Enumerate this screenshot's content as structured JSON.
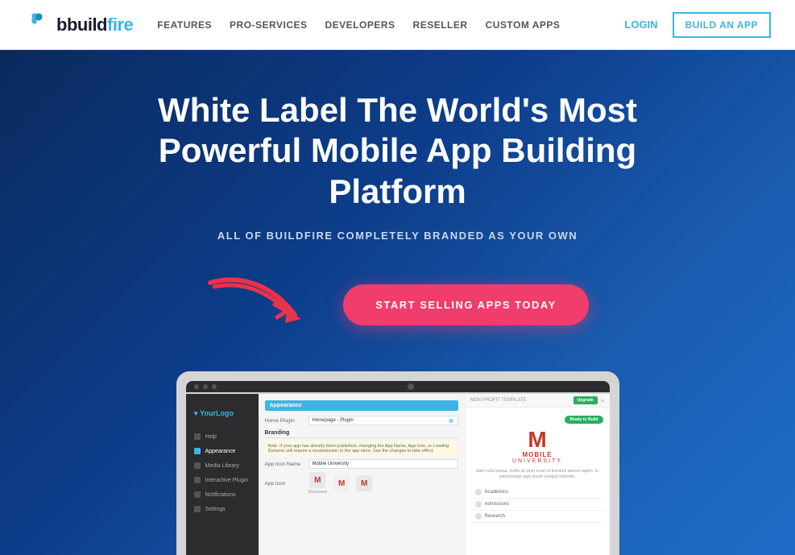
{
  "navbar": {
    "logo_b": "b",
    "logo_build": "build",
    "logo_fire": "fire",
    "links": [
      {
        "id": "features",
        "label": "FEATURES"
      },
      {
        "id": "pro-services",
        "label": "PRO-SERVICES"
      },
      {
        "id": "developers",
        "label": "DEVELOPERS"
      },
      {
        "id": "reseller",
        "label": "RESELLER"
      },
      {
        "id": "custom-apps",
        "label": "CUSTOM APPS"
      }
    ],
    "login_label": "LOGIN",
    "build_label": "BUILD AN APP"
  },
  "hero": {
    "title": "White Label The World's Most Powerful Mobile App Building Platform",
    "subtitle": "ALL OF BUILDFIRE COMPLETELY BRANDED AS YOUR OWN",
    "cta_button": "START SELLING APPS TODAY"
  },
  "app_builder": {
    "logo": "♥ YourLogo",
    "header": "Appearance",
    "template_label": "NON-PROFIT TEMPLATE",
    "upgrade_label": "Upgrade",
    "sidebar_items": [
      {
        "label": "Help",
        "active": false
      },
      {
        "label": "Appearance",
        "active": true
      },
      {
        "label": "Media Library",
        "active": false
      },
      {
        "label": "Interactive Plugin",
        "active": false
      },
      {
        "label": "Notifications",
        "active": false
      },
      {
        "label": "Settings",
        "active": false
      }
    ],
    "section_branding": "Branding",
    "section_appearance": "Appearance",
    "warning_text": "Note: If your app has already been published, changing the App Name, App Icon, or Loading Dynamic will require a resubmission to the app store. See the changes to take effect.",
    "field_home_plugin": "Home Plugin",
    "field_home_plugin_value": "Homepage - Plugin",
    "field_app_name": "App Icon Name",
    "field_app_name_value": "Mobile University",
    "field_app_icon": "App Icon",
    "preview_badge": "Ready to Build",
    "preview_m": "M",
    "preview_name": "MOBILE",
    "preview_subtitle": "UNIVERSITY",
    "preview_description": "Nam nulla massa, mollis sit amet ornat sit tincidunt laoreet sapien. In pellentesque eget ipsum volutpat molestie.",
    "preview_menu": [
      {
        "label": "Academics"
      },
      {
        "label": "Admissions"
      },
      {
        "label": "Research"
      }
    ]
  }
}
